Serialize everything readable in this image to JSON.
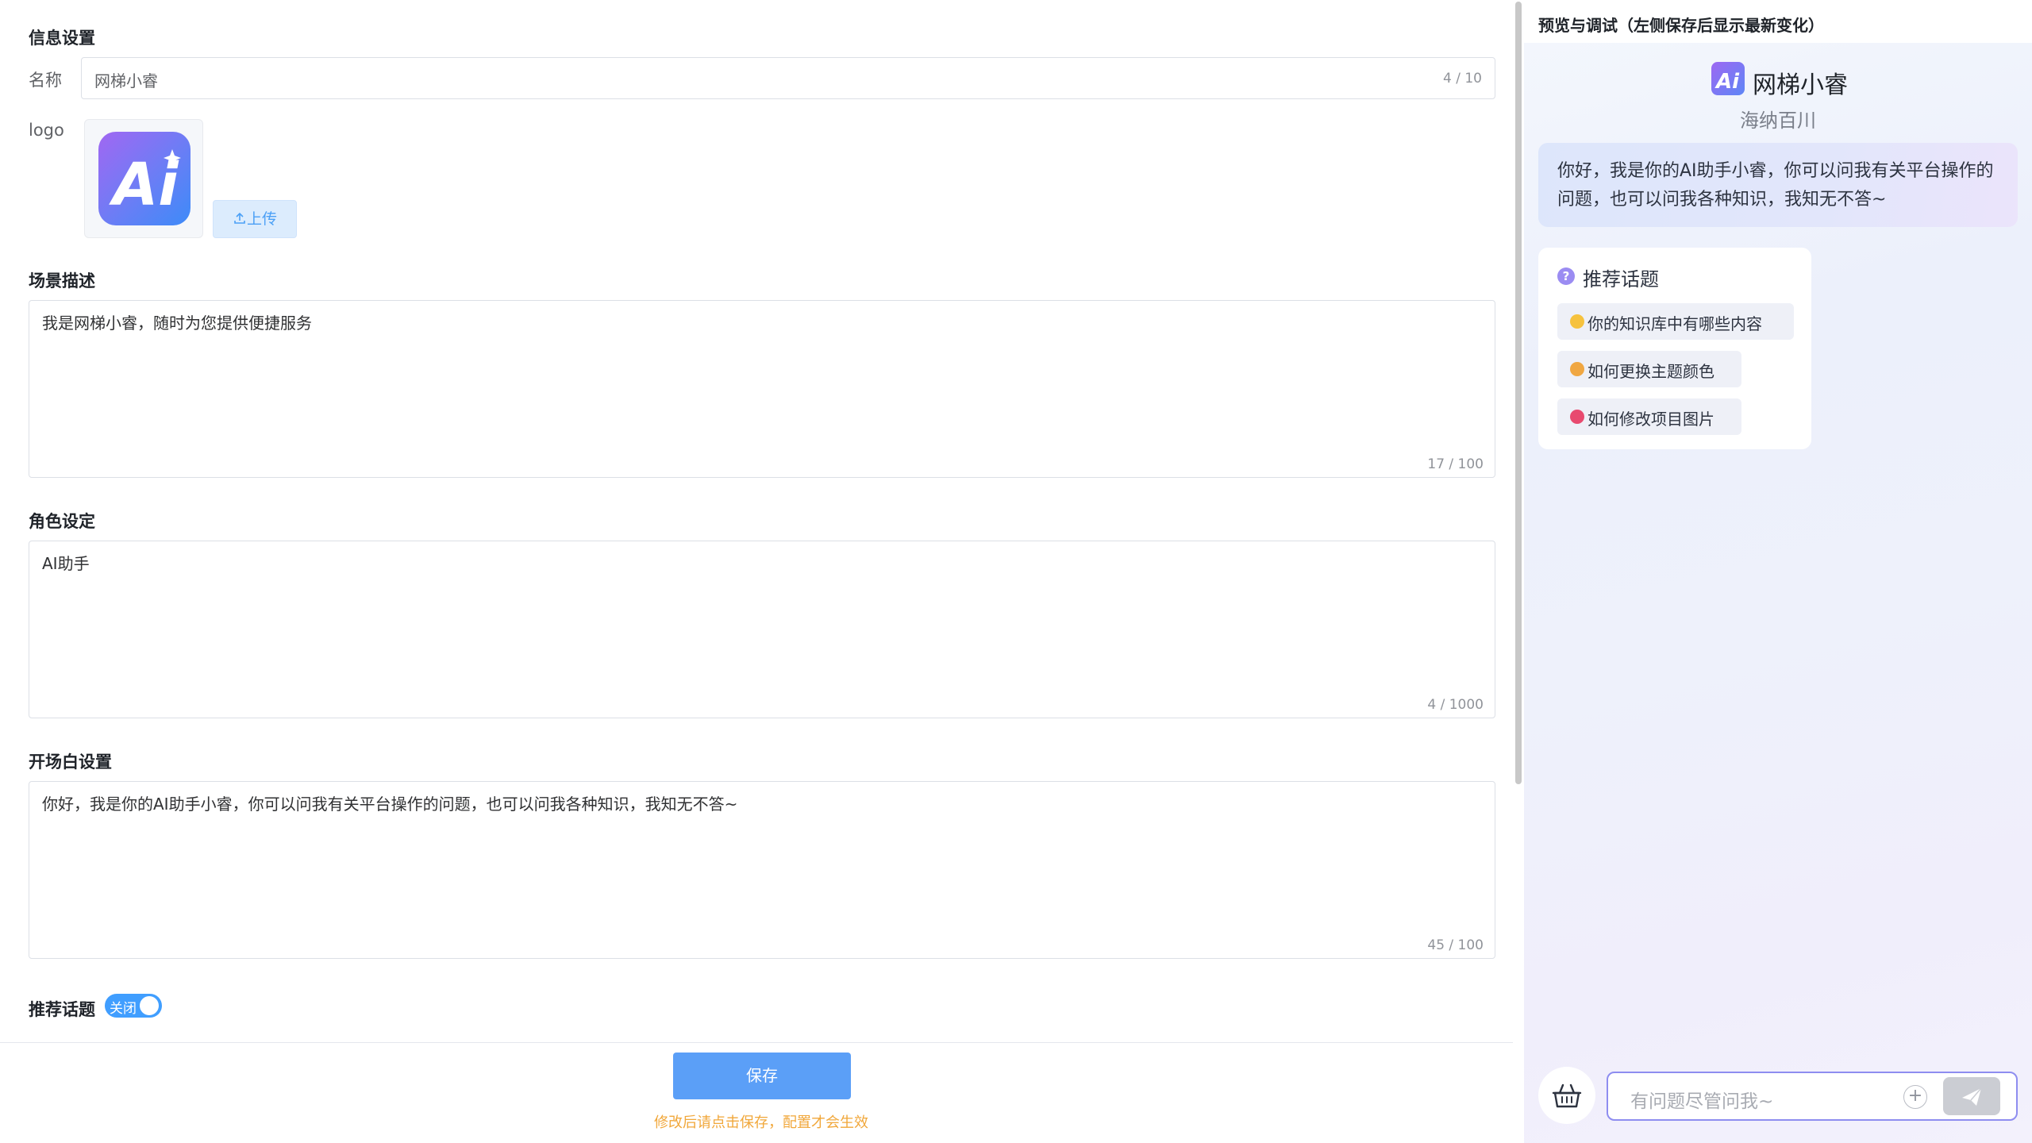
{
  "form": {
    "section_info": "信息设置",
    "name_label": "名称",
    "name_value": "网梯小睿",
    "name_counter": "4 / 10",
    "logo_label": "logo",
    "logo_text": "Ai",
    "upload_label": "上传",
    "scene_title": "场景描述",
    "scene_value": "我是网梯小睿，随时为您提供便捷服务",
    "scene_counter": "17 / 100",
    "role_title": "角色设定",
    "role_value": "AI助手",
    "role_counter": "4 / 1000",
    "opening_title": "开场白设置",
    "opening_value": "你好，我是你的AI助手小睿，你可以问我有关平台操作的问题，也可以问我各种知识，我知无不答~",
    "opening_counter": "45 / 100",
    "topics_title": "推荐话题",
    "toggle_label": "关闭",
    "save_label": "保存",
    "hint": "修改后请点击保存，配置才会生效"
  },
  "preview": {
    "title": "预览与调试（左侧保存后显示最新变化）",
    "brand_name": "网梯小睿",
    "org": "海纳百川",
    "greeting": "你好，我是你的AI助手小睿，你可以问我有关平台操作的问题，也可以问我各种知识，我知无不答~",
    "topics_head": "推荐话题",
    "topics": [
      "你的知识库中有哪些内容",
      "如何更换主题颜色",
      "如何修改项目图片"
    ],
    "input_placeholder": "有问题尽管问我~"
  },
  "colors": {
    "accent": "#409eff",
    "save_button": "#5b9ff7",
    "hint": "#f1a73a",
    "input_border": "#8e8df0"
  }
}
